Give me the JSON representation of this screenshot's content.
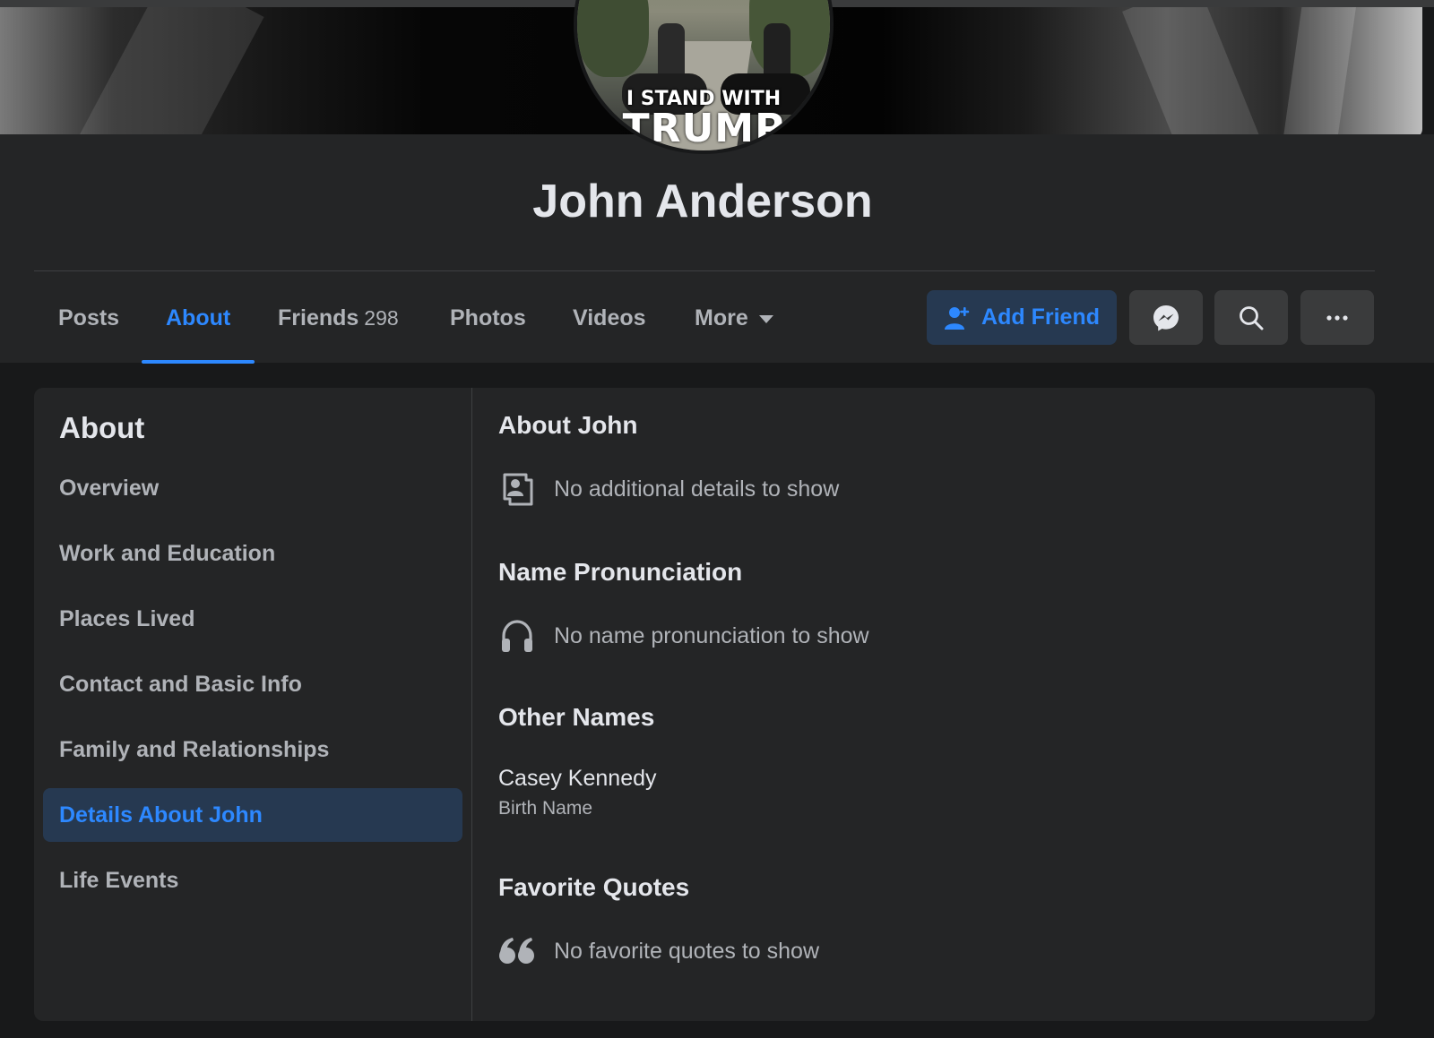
{
  "profile": {
    "name": "John Anderson",
    "profile_photo_text_line1": "I STAND WITH",
    "profile_photo_text_line2": "TRUMP"
  },
  "tabs": [
    {
      "label": "Posts"
    },
    {
      "label": "About",
      "active": true
    },
    {
      "label": "Friends",
      "count": "298"
    },
    {
      "label": "Photos"
    },
    {
      "label": "Videos"
    },
    {
      "label": "More"
    }
  ],
  "actions": {
    "add_friend_label": "Add Friend",
    "messenger_icon": "messenger-icon",
    "search_icon": "search-icon",
    "more_icon": "ellipsis-icon"
  },
  "about_sidebar": {
    "title": "About",
    "items": [
      {
        "label": "Overview"
      },
      {
        "label": "Work and Education"
      },
      {
        "label": "Places Lived"
      },
      {
        "label": "Contact and Basic Info"
      },
      {
        "label": "Family and Relationships"
      },
      {
        "label": "Details About John",
        "selected": true
      },
      {
        "label": "Life Events"
      }
    ]
  },
  "details": {
    "about_title": "About John",
    "about_empty": "No additional details to show",
    "pronunciation_title": "Name Pronunciation",
    "pronunciation_empty": "No name pronunciation to show",
    "other_names_title": "Other Names",
    "other_names": [
      {
        "name": "Casey Kennedy",
        "type": "Birth Name"
      }
    ],
    "quotes_title": "Favorite Quotes",
    "quotes_empty": "No favorite quotes to show"
  },
  "colors": {
    "background": "#18191a",
    "surface": "#242526",
    "accent": "#2d88ff",
    "accent_bg": "#263951",
    "text_primary": "#e4e6eb",
    "text_secondary": "#b0b3b8"
  }
}
